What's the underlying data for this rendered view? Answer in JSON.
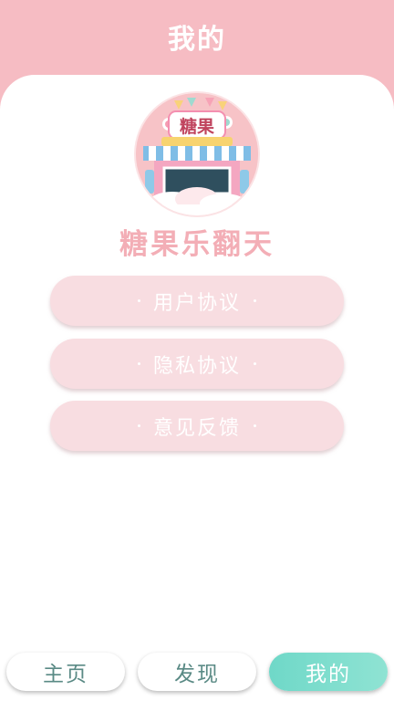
{
  "header": {
    "title": "我的"
  },
  "app": {
    "logo_text": "糖果",
    "name": "糖果乐翻天"
  },
  "menu": [
    {
      "label": "用户协议"
    },
    {
      "label": "隐私协议"
    },
    {
      "label": "意见反馈"
    }
  ],
  "tabs": [
    {
      "label": "主页",
      "active": false
    },
    {
      "label": "发现",
      "active": false
    },
    {
      "label": "我的",
      "active": true
    }
  ],
  "colors": {
    "header": "#f6bcc3",
    "accent_pink": "#f3aeb6",
    "menu_button": "#f8dde1",
    "tab_active": "#6fd8c8",
    "tab_text": "#5a8a85"
  }
}
